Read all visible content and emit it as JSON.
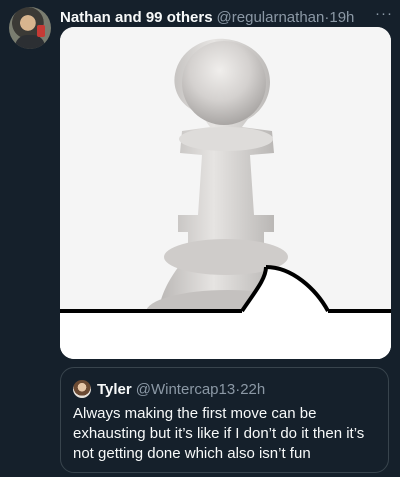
{
  "tweet": {
    "author_name": "Nathan and 99 others",
    "handle": "@regularnathan",
    "separator": "·",
    "time": "19h",
    "more_label": "···"
  },
  "quote": {
    "author_name": "Tyler",
    "handle": "@Wintercap13",
    "separator": "·",
    "time": "22h",
    "text": "Always making the first move can be exhausting but it’s like if I don’t do it then it’s not getting done which also isn’t fun"
  },
  "icons": {
    "avatar": "user-avatar",
    "quote_avatar": "user-avatar",
    "more": "ellipsis-icon"
  }
}
